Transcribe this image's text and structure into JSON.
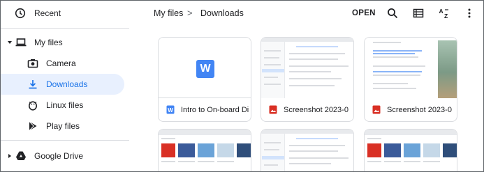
{
  "sidebar": {
    "recent": "Recent",
    "my_files": "My files",
    "camera": "Camera",
    "downloads": "Downloads",
    "linux_files": "Linux files",
    "play_files": "Play files",
    "google_drive": "Google Drive"
  },
  "header": {
    "crumb_root": "My files",
    "crumb_sep": ">",
    "crumb_current": "Downloads",
    "open_label": "OPEN"
  },
  "files": [
    {
      "name": "Intro to On-board Di",
      "type": "word"
    },
    {
      "name": "Screenshot 2023-0",
      "type": "image"
    },
    {
      "name": "Screenshot 2023-0",
      "type": "image"
    }
  ],
  "colors": {
    "accent": "#1a73e8",
    "active_bg": "#e8f0fe",
    "image_icon": "#d93025",
    "word_icon": "#4285f4"
  }
}
